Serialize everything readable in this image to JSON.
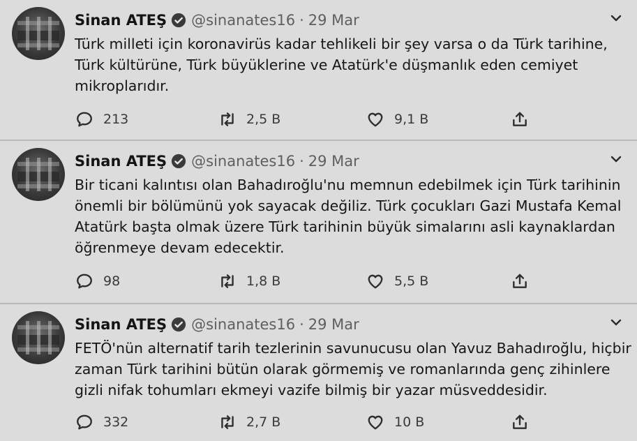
{
  "tweets": [
    {
      "name": "Sinan ATEŞ",
      "handle": "@sinanates16",
      "separator": "·",
      "date": "29 Mar",
      "lines": [
        "Türk milleti için koronavirüs kadar tehlikeli bir şey varsa o da  Türk tarihine,",
        "Türk kültürüne, Türk büyüklerine ve Atatürk'e düşmanlık eden cemiyet",
        "mikroplarıdır."
      ],
      "replies": "213",
      "retweets": "2,5 B",
      "likes": "9,1 B"
    },
    {
      "name": "Sinan ATEŞ",
      "handle": "@sinanates16",
      "separator": "·",
      "date": "29 Mar",
      "lines": [
        "Bir ticani kalıntısı olan Bahadıroğlu'nu memnun edebilmek için Türk tarihinin",
        "önemli bir bölümünü yok sayacak değiliz. Türk çocukları Gazi Mustafa Kemal",
        "Atatürk başta olmak üzere Türk tarihinin büyük simalarını asli kaynaklardan",
        "öğrenmeye devam edecektir."
      ],
      "replies": "98",
      "retweets": "1,8 B",
      "likes": "5,5 B"
    },
    {
      "name": "Sinan ATEŞ",
      "handle": "@sinanates16",
      "separator": "·",
      "date": "29 Mar",
      "lines": [
        "FETÖ'nün alternatif tarih tezlerinin savunucusu olan Yavuz Bahadıroğlu, hiçbir",
        "zaman Türk tarihini bütün olarak görmemiş ve  romanlarında genç zihinlere",
        "gizli nifak tohumları ekmeyi vazife bilmiş bir yazar müsveddesidir."
      ],
      "replies": "332",
      "retweets": "2,7 B",
      "likes": "10 B"
    }
  ],
  "icons": {
    "verified": "verified-badge-icon",
    "caret": "chevron-down-icon",
    "reply": "reply-icon",
    "retweet": "retweet-icon",
    "like": "heart-icon",
    "share": "share-icon"
  },
  "colors": {
    "background": "#dcdcdc",
    "verified": "#3a3a3a",
    "text": "#161616",
    "meta": "#5f5f5f"
  }
}
